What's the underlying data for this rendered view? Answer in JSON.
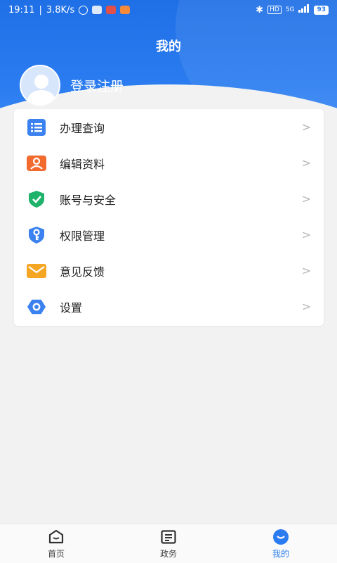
{
  "status_bar": {
    "time": "19:11",
    "speed": "3.8K/s",
    "network": "5G",
    "battery": "93"
  },
  "header": {
    "title": "我的"
  },
  "profile": {
    "login_label": "登录注册"
  },
  "menu": {
    "items": [
      {
        "label": "办理查询",
        "icon": "list-icon",
        "color": "#3b82f0"
      },
      {
        "label": "编辑资料",
        "icon": "profile-edit-icon",
        "color": "#f26a2e"
      },
      {
        "label": "账号与安全",
        "icon": "shield-check-icon",
        "color": "#1fb26a"
      },
      {
        "label": "权限管理",
        "icon": "key-shield-icon",
        "color": "#3b82f0"
      },
      {
        "label": "意见反馈",
        "icon": "envelope-icon",
        "color": "#f5a623"
      },
      {
        "label": "设置",
        "icon": "settings-icon",
        "color": "#3b82f0"
      }
    ]
  },
  "bottom_nav": {
    "items": [
      {
        "label": "首页",
        "icon": "home-icon"
      },
      {
        "label": "政务",
        "icon": "document-icon"
      },
      {
        "label": "我的",
        "icon": "profile-smile-icon",
        "active": true
      }
    ]
  },
  "colors": {
    "primary": "#2a7cf0",
    "background": "#f2f2f2"
  }
}
